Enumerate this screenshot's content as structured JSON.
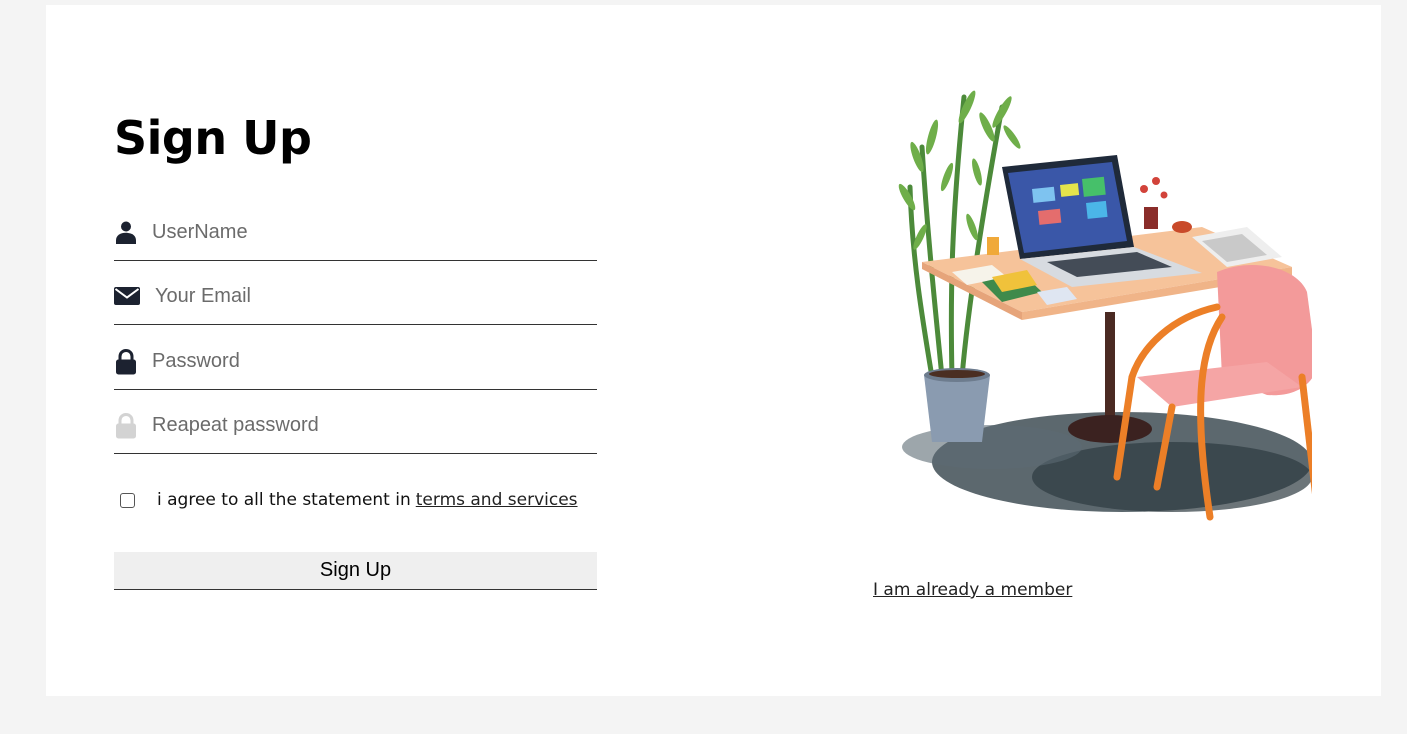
{
  "form": {
    "title": "Sign Up",
    "fields": {
      "username": {
        "placeholder": "UserName",
        "icon": "user-icon"
      },
      "email": {
        "placeholder": "Your Email",
        "icon": "envelope-icon"
      },
      "password": {
        "placeholder": "Password",
        "icon": "lock-icon"
      },
      "repeat_password": {
        "placeholder": "Reapeat password",
        "icon": "lock-icon"
      }
    },
    "agree": {
      "text": "i agree to all the statement in",
      "link": "terms and services",
      "checked": false
    },
    "submit_label": "Sign Up"
  },
  "side": {
    "illustration": "desk-laptop-chair-illustration",
    "member_link": "I am already a member"
  },
  "colors": {
    "background": "#f4f4f4",
    "card": "#ffffff",
    "icon_dark": "#1c2230",
    "icon_muted": "#d3d3d3",
    "button": "#efefef"
  }
}
